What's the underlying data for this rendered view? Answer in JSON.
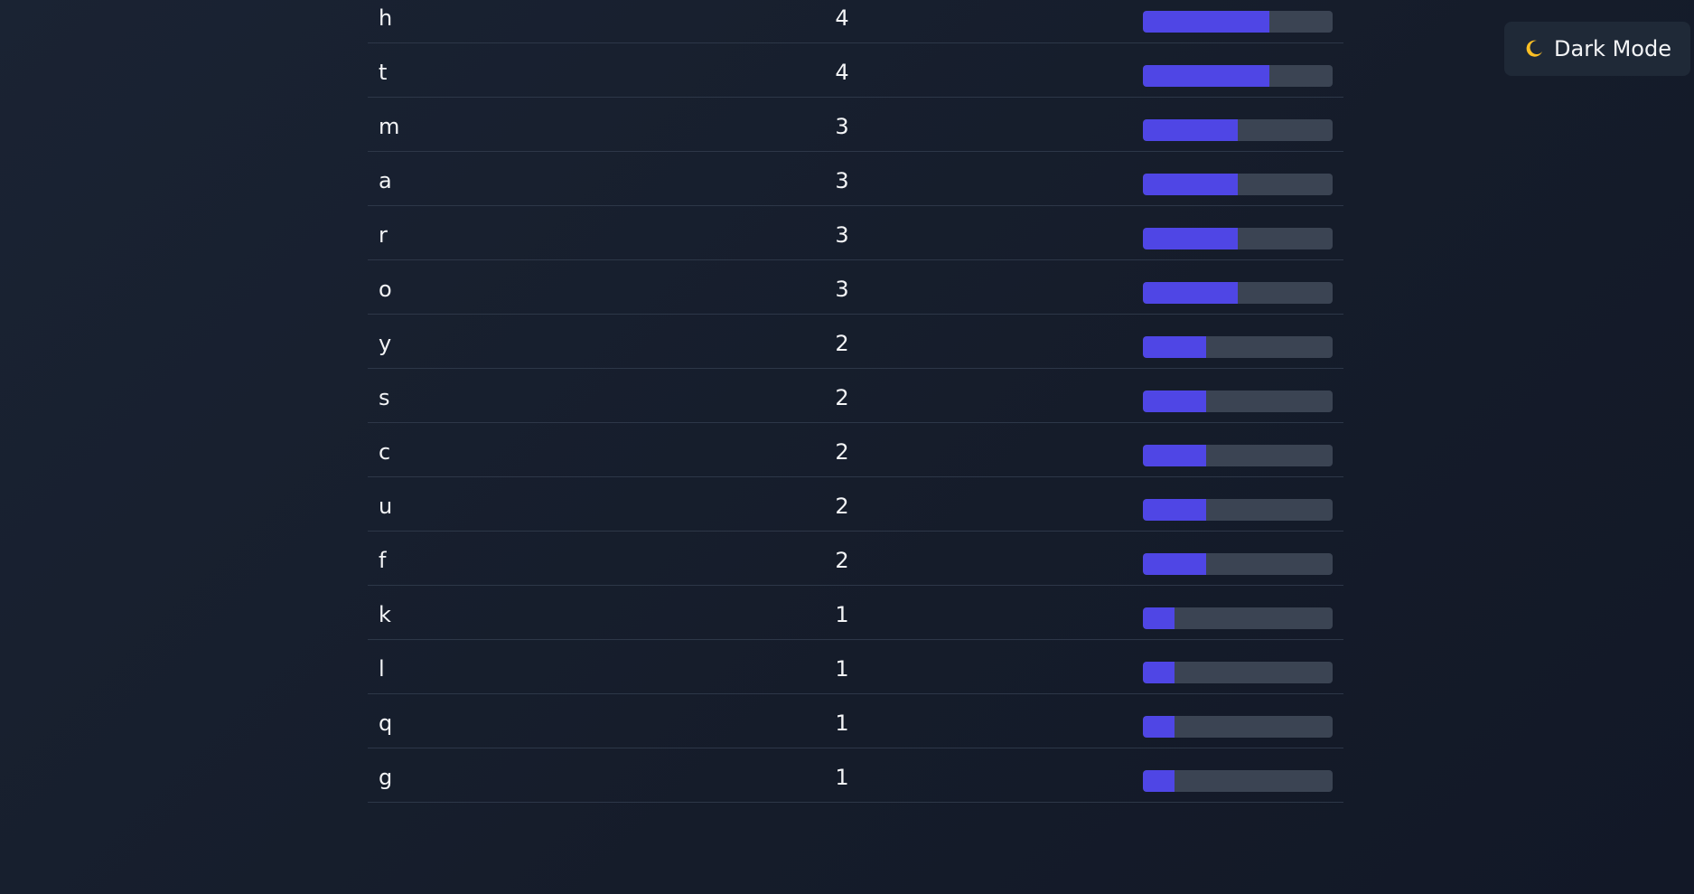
{
  "theme_toggle": {
    "label": "Dark Mode",
    "icon": "moon-icon",
    "icon_color": "#fbbf24"
  },
  "frequency_table": {
    "max_count": 6,
    "fill_color": "#4f46e5",
    "track_color": "#3b4453",
    "rows": [
      {
        "char": "h",
        "count": "4",
        "fraction": 0.667
      },
      {
        "char": "t",
        "count": "4",
        "fraction": 0.667
      },
      {
        "char": "m",
        "count": "3",
        "fraction": 0.5
      },
      {
        "char": "a",
        "count": "3",
        "fraction": 0.5
      },
      {
        "char": "r",
        "count": "3",
        "fraction": 0.5
      },
      {
        "char": "o",
        "count": "3",
        "fraction": 0.5
      },
      {
        "char": "y",
        "count": "2",
        "fraction": 0.333
      },
      {
        "char": "s",
        "count": "2",
        "fraction": 0.333
      },
      {
        "char": "c",
        "count": "2",
        "fraction": 0.333
      },
      {
        "char": "u",
        "count": "2",
        "fraction": 0.333
      },
      {
        "char": "f",
        "count": "2",
        "fraction": 0.333
      },
      {
        "char": "k",
        "count": "1",
        "fraction": 0.167
      },
      {
        "char": "l",
        "count": "1",
        "fraction": 0.167
      },
      {
        "char": "q",
        "count": "1",
        "fraction": 0.167
      },
      {
        "char": "g",
        "count": "1",
        "fraction": 0.167
      }
    ]
  }
}
